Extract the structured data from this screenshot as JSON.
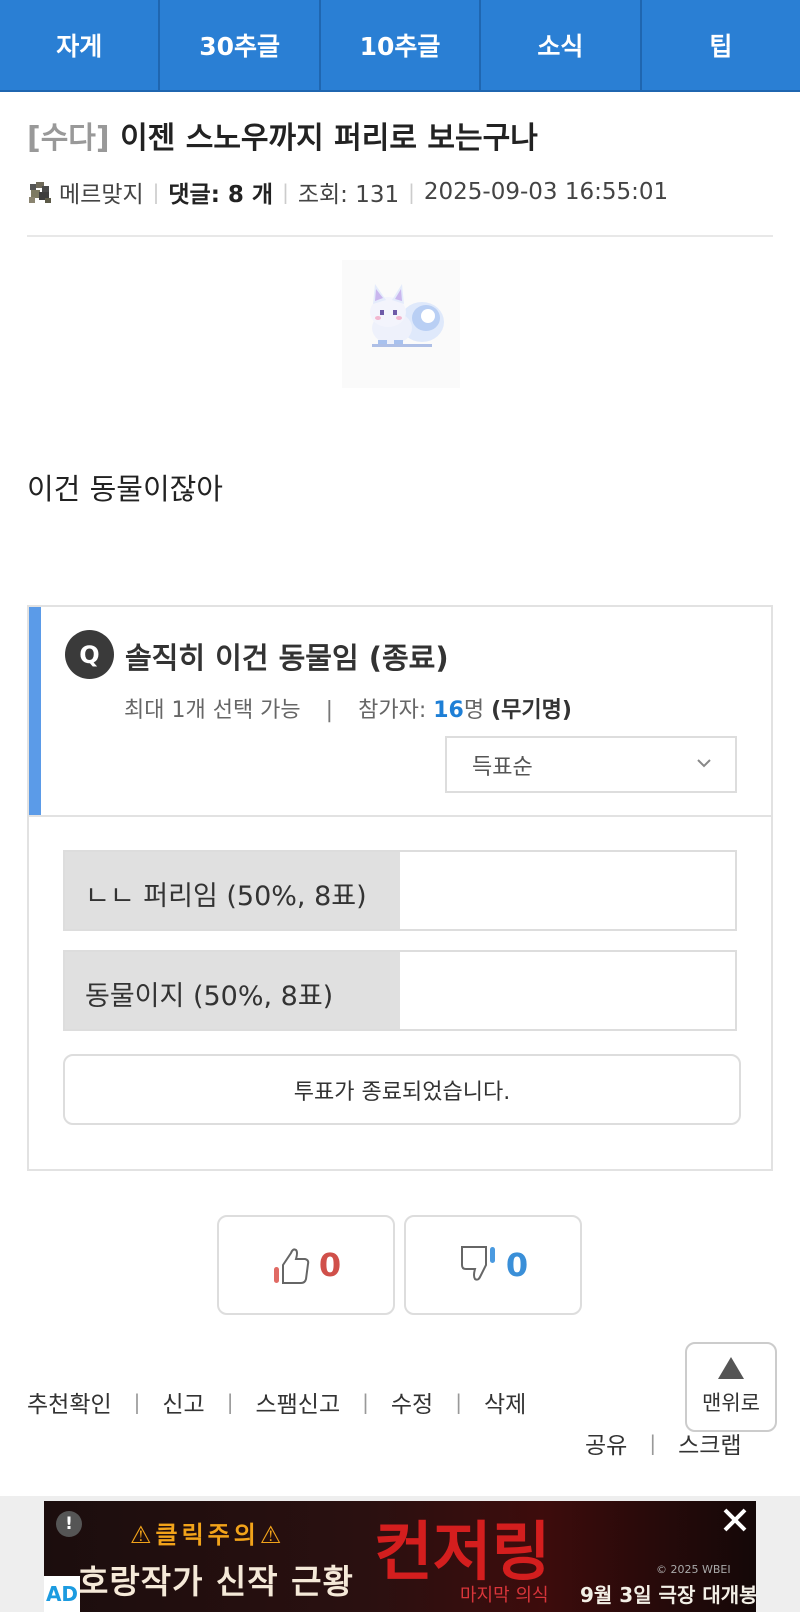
{
  "nav": {
    "tabs": [
      "자게",
      "30추글",
      "10추글",
      "소식",
      "팁"
    ]
  },
  "post": {
    "category": "[수다]",
    "title": "이젠 스노우까지 퍼리로 보는구나",
    "author": "메르맞지",
    "comments_label": "댓글: 8 개",
    "views_label": "조회: 131",
    "datetime": "2025-09-03 16:55:01",
    "body": "이건 동물이잖아"
  },
  "poll": {
    "badge": "Q",
    "question": "솔직히 이건 동물임 (종료)",
    "max_select": "최대 1개 선택 가능",
    "pipe": "|",
    "participants_prefix": "참가자: ",
    "participants_count": "16",
    "participants_suffix": "명",
    "anonymous": "(무기명)",
    "sort": "득표순",
    "options": [
      {
        "label": "ㄴㄴ 퍼리임 (50%, 8표)",
        "percent": 50
      },
      {
        "label": "동물이지 (50%, 8표)",
        "percent": 50
      }
    ],
    "status": "투표가 종료되었습니다."
  },
  "votes": {
    "up": "0",
    "down": "0"
  },
  "actions": {
    "items": [
      "추천확인",
      "신고",
      "스팸신고",
      "수정",
      "삭제"
    ],
    "items2": [
      "공유",
      "스크랩"
    ]
  },
  "top_button": "맨위로",
  "ad": {
    "label": "AD",
    "info": "!",
    "warning": "⚠클릭주의⚠",
    "headline": "호랑작가 신작 근황",
    "title": "컨저링",
    "subtitle": "마지막 의식",
    "release": "9월 3일 극장 대개봉",
    "copyright": "© 2025 WBEI"
  },
  "colors": {
    "nav": "#2a7fd4",
    "accent": "#5b9be8",
    "up": "#d0504a",
    "down": "#3a8fd8"
  }
}
